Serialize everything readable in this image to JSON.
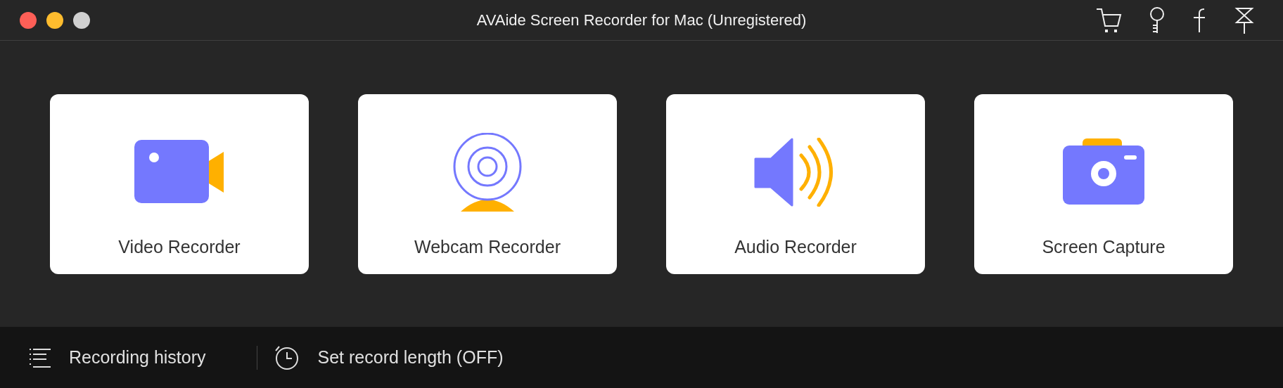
{
  "window": {
    "title": "AVAide Screen Recorder for Mac (Unregistered)"
  },
  "cards": [
    {
      "kind": "video",
      "label": "Video Recorder"
    },
    {
      "kind": "webcam",
      "label": "Webcam Recorder"
    },
    {
      "kind": "audio",
      "label": "Audio Recorder"
    },
    {
      "kind": "capture",
      "label": "Screen Capture"
    }
  ],
  "bottom_bar": {
    "history": "Recording history",
    "record_length": "Set record length (OFF)"
  }
}
